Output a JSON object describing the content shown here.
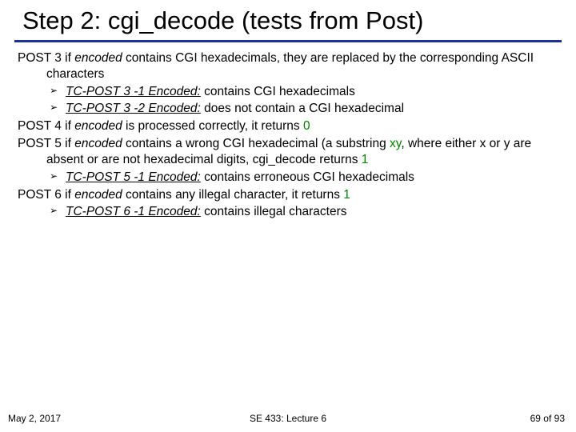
{
  "title": "Step 2: cgi_decode (tests from Post)",
  "posts": {
    "p3": {
      "label": "POST 3",
      "text_a": " if ",
      "enc": "encoded",
      "text_b": " contains CGI hexadecimals, they are replaced by the corresponding ASCII characters",
      "subs": [
        {
          "tc": "TC-POST 3 -1 Encoded:",
          "rest": " contains CGI hexadecimals"
        },
        {
          "tc": "TC-POST 3 -2 Encoded:",
          "rest": " does not contain a CGI hexadecimal"
        }
      ]
    },
    "p4": {
      "label": "POST 4",
      "text_a": " if ",
      "enc": "encoded",
      "text_b": " is processed correctly, it returns ",
      "ret": "0"
    },
    "p5": {
      "label": "POST 5",
      "text_a": " if ",
      "enc": "encoded",
      "text_b": " contains a wrong CGI hexadecimal (a substring ",
      "xy": "xy",
      "text_c": ", where either x or y are absent or are not hexadecimal digits, cgi_decode returns ",
      "ret": "1",
      "subs": [
        {
          "tc": "TC-POST 5 -1 Encoded:",
          "rest": " contains erroneous CGI hexadecimals"
        }
      ]
    },
    "p6": {
      "label": "POST 6",
      "text_a": " if ",
      "enc": "encoded",
      "text_b": " contains any illegal character, it returns ",
      "ret": "1",
      "subs": [
        {
          "tc": "TC-POST 6 -1 Encoded:",
          "rest": " contains illegal characters"
        }
      ]
    }
  },
  "footer": {
    "left": "May 2, 2017",
    "center": "SE 433: Lecture 6",
    "page_cur": "69",
    "page_sep": " of ",
    "page_tot": "93"
  },
  "marker": "➢"
}
